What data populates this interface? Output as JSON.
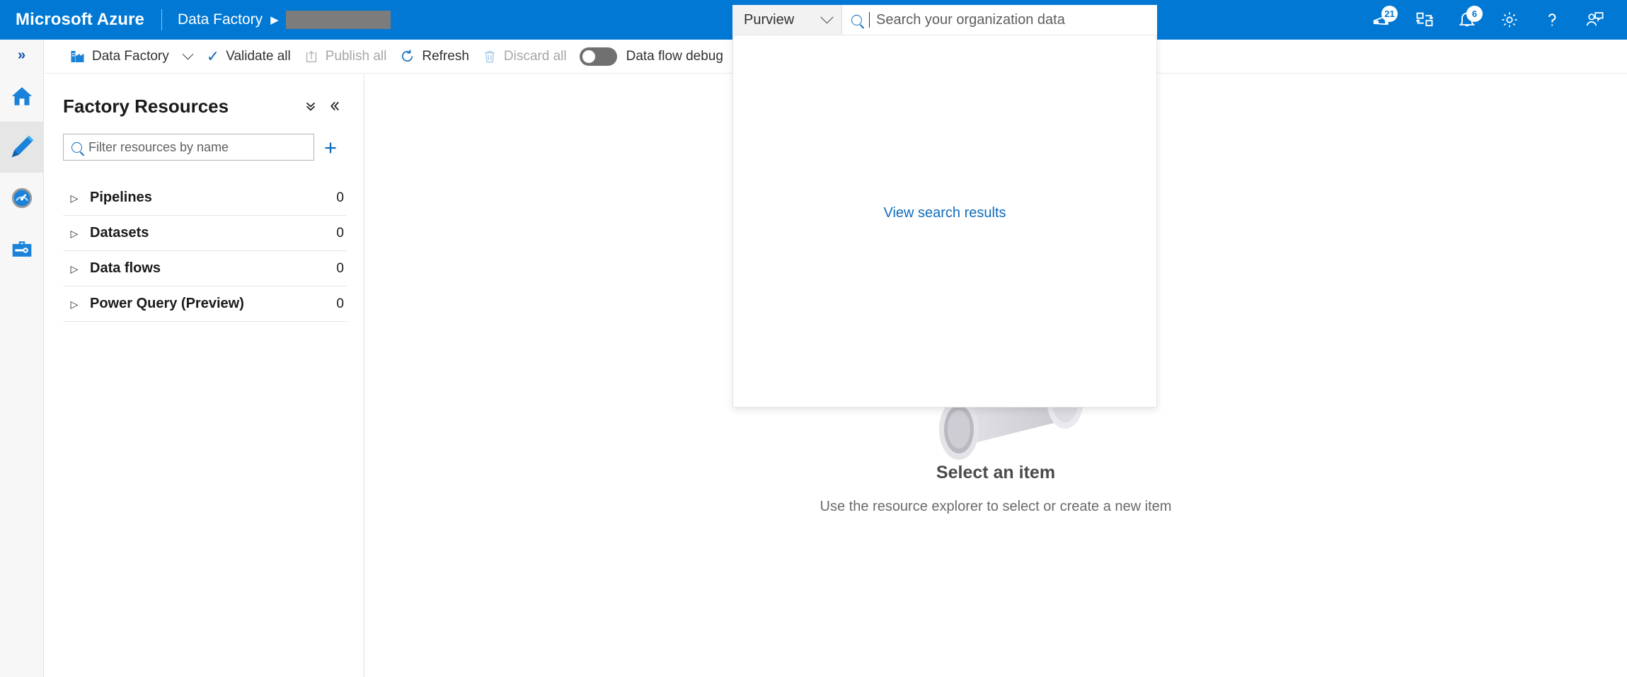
{
  "topbar": {
    "brand": "Microsoft Azure",
    "breadcrumb_service": "Data Factory",
    "breadcrumb_arrow": "▶",
    "accent_color": "#0078d4",
    "icons": [
      {
        "name": "announcements-icon",
        "badge": "21"
      },
      {
        "name": "cloud-shell-icon",
        "badge": ""
      },
      {
        "name": "notifications-bell-icon",
        "badge": "6"
      },
      {
        "name": "settings-gear-icon",
        "badge": ""
      },
      {
        "name": "help-question-icon",
        "badge": ""
      },
      {
        "name": "feedback-person-icon",
        "badge": ""
      }
    ]
  },
  "search": {
    "scope_label": "Purview",
    "placeholder": "Search your organization data",
    "value": "",
    "flyout_link": "View search results",
    "link_color": "#0f6cbd"
  },
  "rail": {
    "expand_glyph": "»",
    "items": [
      {
        "label": "Home",
        "icon": "home-icon",
        "selected": false
      },
      {
        "label": "Author",
        "icon": "pencil-author-icon",
        "selected": true
      },
      {
        "label": "Monitor",
        "icon": "monitor-gauge-icon",
        "selected": false
      },
      {
        "label": "Manage",
        "icon": "toolbox-manage-icon",
        "selected": false
      }
    ]
  },
  "toolbar": {
    "factory_label": "Data Factory",
    "validate_all": "Validate all",
    "publish_all": "Publish all",
    "refresh": "Refresh",
    "discard_all": "Discard all",
    "data_flow_debug": "Data flow debug",
    "toggle_state": "off"
  },
  "resources": {
    "title": "Factory Resources",
    "collapse_all_icon": "double-chevron-down-icon",
    "collapse_panel_icon": "double-chevron-left-icon",
    "filter_placeholder": "Filter resources by name",
    "filter_value": "",
    "add_label": "+",
    "tree": [
      {
        "label": "Pipelines",
        "count": "0"
      },
      {
        "label": "Datasets",
        "count": "0"
      },
      {
        "label": "Data flows",
        "count": "0"
      },
      {
        "label": "Power Query (Preview)",
        "count": "0"
      }
    ]
  },
  "empty_state": {
    "title": "Select an item",
    "subtitle": "Use the resource explorer to select or create a new item",
    "illustration": "isometric-data-shapes"
  }
}
